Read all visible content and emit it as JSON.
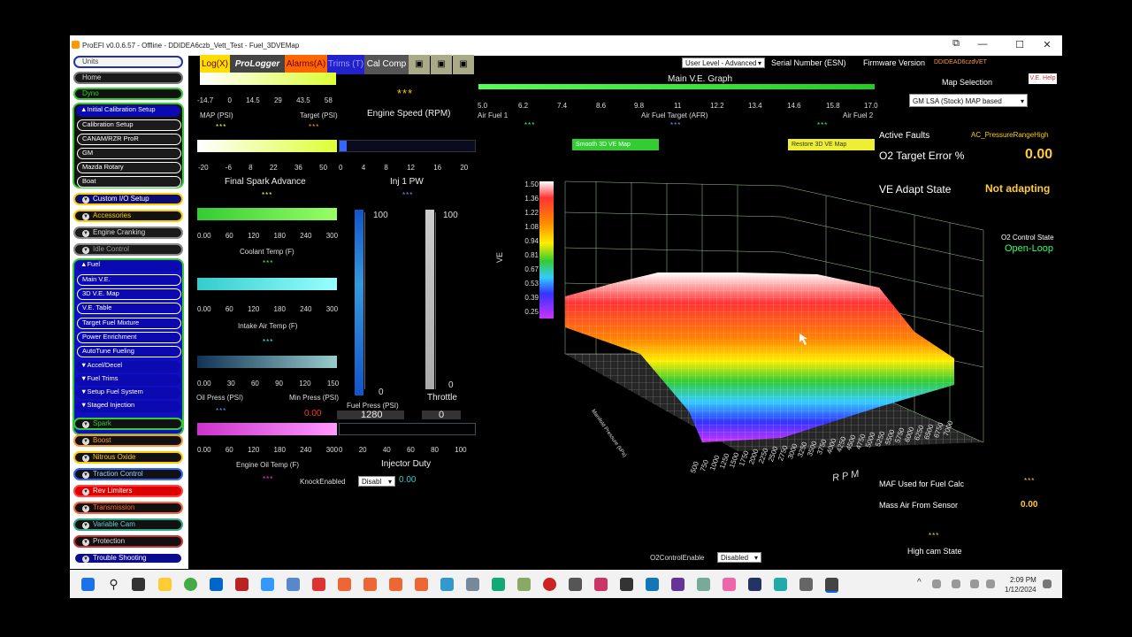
{
  "window": {
    "title": "ProEFI v0.0.6.57 - Offline - DDIDEA6czb_Vett_Test - Fuel_3DVEMap",
    "min": "—",
    "max": "☐",
    "close": "✕"
  },
  "sidebar": {
    "top_items": [
      "Units",
      "Home",
      "Dyno"
    ],
    "initial_cal": {
      "label": "Initial Calibration Setup",
      "items": [
        "Calibration Setup",
        "CANAM/RZR ProR",
        "GM",
        "Mazda Rotary",
        "Boat"
      ]
    },
    "mid_items": [
      "Custom I/O Setup",
      "Accessories",
      "Engine Cranking",
      "Idle Control"
    ],
    "fuel": {
      "label": "Fuel",
      "items": [
        "Main V.E.",
        "3D V.E. Map",
        "V.E. Table",
        "Target Fuel Mixture",
        "Power Enrichment",
        "AutoTune Fueling"
      ],
      "plain_items": [
        "Accel/Decel",
        "Fuel Trims",
        "Setup Fuel System",
        "Staged Injection"
      ]
    },
    "bottom_items": [
      "Spark",
      "Boost",
      "Nitrous Oxide",
      "Traction Control",
      "Rev Limiters",
      "Transmission",
      "Variable Cam",
      "Protection",
      "Trouble Shooting"
    ]
  },
  "tabs": {
    "log": "Log(X)",
    "prologger": "ProLogger",
    "alarms": "Alarms(A)",
    "trims": "Trims (T)",
    "calcomp": "Cal Comp"
  },
  "header": {
    "user_level": "User Level - Advanced",
    "serial_label": "Serial Number (ESN)",
    "firmware_label": "Firmware Version",
    "firmware_value": "DDIDEAD6czdVET",
    "ve_help": "V.E. Help",
    "map_selection_label": "Map Selection",
    "map_selection_value": "GM LSA (Stock) MAP based"
  },
  "gauges": {
    "map": {
      "ticks": [
        "-14.7",
        "0",
        "14.5",
        "29",
        "43.5",
        "58"
      ],
      "label1": "MAP (PSI)",
      "label2": "Target (PSI)",
      "dots1": "***",
      "dots2": "***",
      "fill": 1.0
    },
    "engine_speed": {
      "label": "Engine Speed (RPM)",
      "dots": "***"
    },
    "spark": {
      "ticks": [
        "-20",
        "-6",
        "8",
        "22",
        "36",
        "50"
      ],
      "label": "Final Spark Advance",
      "dots": "***",
      "fill": 1.0
    },
    "inj_pw": {
      "ticks": [
        "0",
        "4",
        "8",
        "12",
        "16",
        "20"
      ],
      "label": "Inj 1 PW",
      "dots": "***",
      "fill": 0.05
    },
    "coolant": {
      "ticks": [
        "0.00",
        "60",
        "120",
        "180",
        "240",
        "300"
      ],
      "label": "Coolant Temp (F)",
      "dots": "***",
      "fill": 1.0
    },
    "intake": {
      "ticks": [
        "0.00",
        "60",
        "120",
        "180",
        "240",
        "300"
      ],
      "label": "Intake Air Temp (F)",
      "dots": "***",
      "fill": 1.0
    },
    "oil": {
      "ticks": [
        "0.00",
        "30",
        "60",
        "90",
        "120",
        "150"
      ],
      "label1": "Oil Press (PSI)",
      "label2": "Min Press (PSI)",
      "dots": "***",
      "value": "0.00",
      "fill": 1.0
    },
    "fuel_press": {
      "top": "100",
      "bottom": "0",
      "label": "Fuel Press (PSI)",
      "value": "1280"
    },
    "throttle": {
      "top": "100",
      "bottom": "0",
      "label": "Throttle",
      "value": "0"
    },
    "oil_temp": {
      "ticks": [
        "0.00",
        "60",
        "120",
        "180",
        "240",
        "300"
      ],
      "label": "Engine Oil Temp (F)",
      "dots": "***",
      "fill": 1.0
    },
    "inj_duty": {
      "ticks": [
        "0",
        "20",
        "40",
        "60",
        "80",
        "100"
      ],
      "label": "Injector Duty",
      "fill": 0.0
    },
    "knock": {
      "label": "KnockEnabled",
      "select": "Disabl",
      "value": "0.00"
    }
  },
  "graph": {
    "title": "Main V.E. Graph",
    "afr_ticks": [
      "5.0",
      "6.2",
      "7.4",
      "8.6",
      "9.8",
      "11",
      "12.2",
      "13.4",
      "14.6",
      "15.8",
      "17.0"
    ],
    "af1": "Air Fuel 1",
    "aft": "Air Fuel Target (AFR)",
    "af2": "Air Fuel 2",
    "dots1": "***",
    "dots2": "***",
    "dots3": "***",
    "smooth_btn": "Smooth 3D VE Map",
    "restore_btn": "Restore 3D VE Map",
    "ve_axis": "VE",
    "scale": [
      "1.50",
      "1.36",
      "1.22",
      "1.08",
      "0.94",
      "0.81",
      "0.67",
      "0.53",
      "0.39",
      "0.25"
    ],
    "rpm_axis": "RPM",
    "map_axis": "Manifold Pressure (kPa)",
    "rpm_ticks": [
      "500",
      "750",
      "1000",
      "1250",
      "1500",
      "1750",
      "2000",
      "2250",
      "2500",
      "2750",
      "3000",
      "3250",
      "3500",
      "3750",
      "4000",
      "4250",
      "4500",
      "4750",
      "5000",
      "5250",
      "5500",
      "5750",
      "6000",
      "6250",
      "6500",
      "6750",
      "7000"
    ]
  },
  "status": {
    "active_faults_label": "Active Faults",
    "active_faults_value": "AC_PressureRangeHigh",
    "o2_error_label": "O2 Target Error %",
    "o2_error_value": "0.00",
    "ve_adapt_label": "VE Adapt State",
    "ve_adapt_value": "Not adapting",
    "o2_control_label": "O2 Control State",
    "o2_control_value": "Open-Loop",
    "maf_label": "MAF Used for Fuel Calc",
    "maf_value": "***",
    "mass_air_label": "Mass Air From Sensor",
    "mass_air_value": "0.00",
    "high_cam_dots": "***",
    "high_cam_label": "High cam State",
    "o2_enable_label": "O2ControlEnable",
    "o2_enable_value": "Disabled"
  },
  "taskbar": {
    "time": "2:09 PM",
    "date": "1/12/2024"
  },
  "colors": {
    "accent_yellow": "#ffcc33",
    "blue_nav": "#0a0ab0",
    "green_border": "#33cc33"
  }
}
